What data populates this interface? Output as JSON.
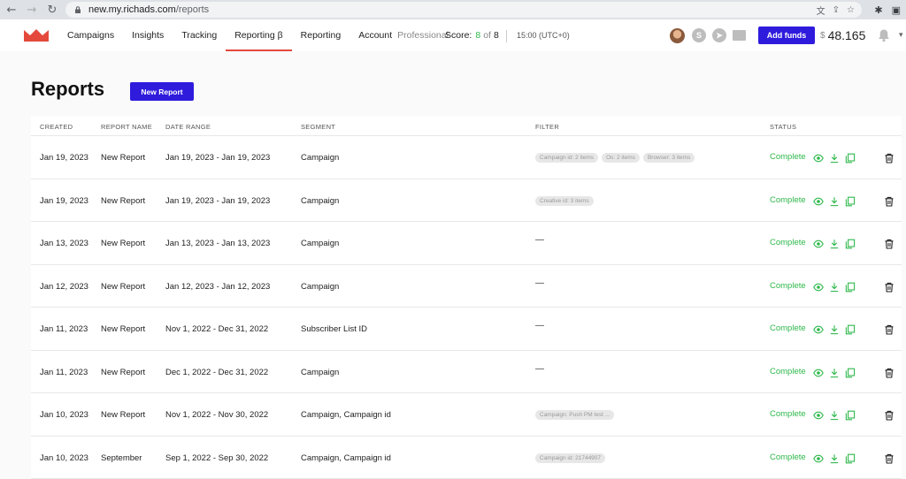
{
  "browser": {
    "url_host": "new.my.richads.com",
    "url_path": "/reports"
  },
  "nav": {
    "items": [
      {
        "label": "Campaigns"
      },
      {
        "label": "Insights"
      },
      {
        "label": "Tracking"
      },
      {
        "label": "Reporting β",
        "active": true
      },
      {
        "label": "Reporting"
      },
      {
        "label": "Account",
        "sub": "Professional"
      }
    ],
    "score_label": "Score:",
    "score_value": "8",
    "score_of": "of",
    "score_total": "8",
    "time": "15:00 (UTC+0)",
    "add_funds_label": "Add funds",
    "currency": "$",
    "balance": "48.165"
  },
  "page": {
    "title": "Reports",
    "new_report_label": "New Report"
  },
  "table": {
    "columns": [
      "CREATED",
      "REPORT NAME",
      "DATE RANGE",
      "SEGMENT",
      "FILTER",
      "STATUS"
    ],
    "rows": [
      {
        "created": "Jan 19, 2023",
        "name": "New Report",
        "range": "Jan 19, 2023 - Jan 19, 2023",
        "segment": "Campaign",
        "filter": [
          "Campaign id: 2 items",
          "Os: 2 items",
          "Browser: 3 items"
        ],
        "status": "Complete"
      },
      {
        "created": "Jan 19, 2023",
        "name": "New Report",
        "range": "Jan 19, 2023 - Jan 19, 2023",
        "segment": "Campaign",
        "filter": [
          "Creative id: 3 items"
        ],
        "status": "Complete"
      },
      {
        "created": "Jan 13, 2023",
        "name": "New Report",
        "range": "Jan 13, 2023 - Jan 13, 2023",
        "segment": "Campaign",
        "filter": [],
        "status": "Complete"
      },
      {
        "created": "Jan 12, 2023",
        "name": "New Report",
        "range": "Jan 12, 2023 - Jan 12, 2023",
        "segment": "Campaign",
        "filter": [],
        "status": "Complete"
      },
      {
        "created": "Jan 11, 2023",
        "name": "New Report",
        "range": "Nov 1, 2022 - Dec 31, 2022",
        "segment": "Subscriber List ID",
        "filter": [],
        "status": "Complete"
      },
      {
        "created": "Jan 11, 2023",
        "name": "New Report",
        "range": "Dec 1, 2022 - Dec 31, 2022",
        "segment": "Campaign",
        "filter": [],
        "status": "Complete"
      },
      {
        "created": "Jan 10, 2023",
        "name": "New Report",
        "range": "Nov 1, 2022 - Nov 30, 2022",
        "segment": "Campaign, Campaign id",
        "filter": [
          "Campaign: Push PM test ..."
        ],
        "status": "Complete"
      },
      {
        "created": "Jan 10, 2023",
        "name": "September",
        "range": "Sep 1, 2022 - Sep 30, 2022",
        "segment": "Campaign, Campaign id",
        "filter": [
          "Campaign id: 21744907"
        ],
        "status": "Complete"
      }
    ],
    "empty_filter": "—"
  },
  "colors": {
    "accent": "#2f1bdc",
    "success": "#2eb84b",
    "nav_active": "#e4493c",
    "logo": "#e4493c"
  }
}
